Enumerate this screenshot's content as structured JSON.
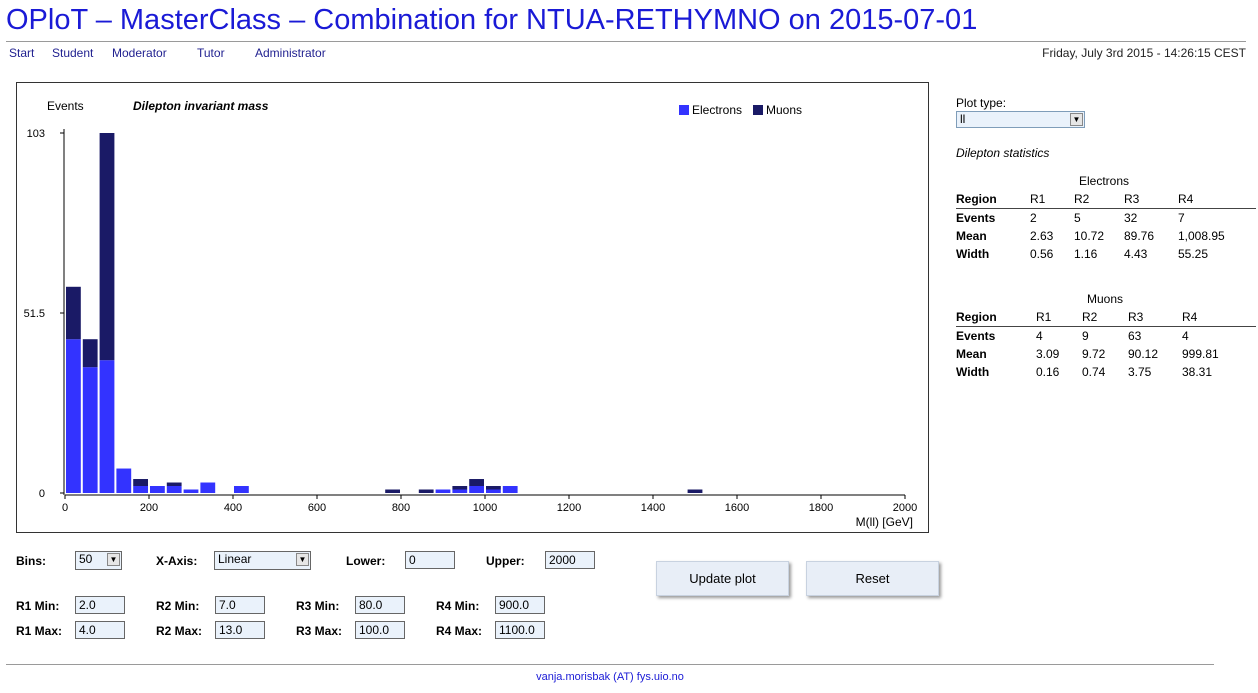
{
  "page": {
    "title": "OPloT – MasterClass – Combination for NTUA-RETHYMNO on 2015-07-01",
    "datetime": "Friday, July 3rd 2015 - 14:26:15 CEST",
    "footer": "vanja.morisbak (AT) fys.uio.no"
  },
  "nav": {
    "start": "Start",
    "student": "Student",
    "moderator": "Moderator",
    "tutor": "Tutor",
    "administrator": "Administrator"
  },
  "colors": {
    "electrons": "#3333ff",
    "muons": "#1a1a66",
    "title": "#1a1ad6"
  },
  "chart_data": {
    "type": "bar",
    "stacked": true,
    "title": "Dilepton invariant mass",
    "ylabel": "Events",
    "xlabel": "M(ll) [GeV]",
    "xlim": [
      0,
      2000
    ],
    "ylim": [
      0,
      103
    ],
    "x_ticks": [
      "0",
      "200",
      "400",
      "600",
      "800",
      "1000",
      "1200",
      "1400",
      "1600",
      "1800",
      "2000"
    ],
    "y_ticks": [
      "0",
      "51.5",
      "103"
    ],
    "legend": "top-right",
    "bin_width": 40,
    "bin_starts": [
      0,
      40,
      80,
      120,
      160,
      200,
      240,
      280,
      320,
      400,
      760,
      840,
      880,
      920,
      960,
      1000,
      1040,
      1480
    ],
    "series": [
      {
        "name": "Electrons",
        "values": [
          44,
          36,
          38,
          7,
          2,
          2,
          2,
          1,
          3,
          2,
          0,
          0,
          1,
          1,
          2,
          1,
          2,
          0
        ]
      },
      {
        "name": "Muons",
        "values": [
          15,
          8,
          65,
          0,
          2,
          0,
          1,
          0,
          0,
          0,
          1,
          1,
          0,
          1,
          2,
          1,
          0,
          1
        ]
      }
    ]
  },
  "side": {
    "plot_type_label": "Plot type:",
    "plot_type_value": "ll",
    "stats_title": "Dilepton statistics"
  },
  "electrons_table": {
    "caption": "Electrons",
    "headers": [
      "Region",
      "R1",
      "R2",
      "R3",
      "R4"
    ],
    "rows": [
      [
        "Events",
        "2",
        "5",
        "32",
        "7"
      ],
      [
        "Mean",
        "2.63",
        "10.72",
        "89.76",
        "1,008.95"
      ],
      [
        "Width",
        "0.56",
        "1.16",
        "4.43",
        "55.25"
      ]
    ]
  },
  "muons_table": {
    "caption": "Muons",
    "headers": [
      "Region",
      "R1",
      "R2",
      "R3",
      "R4"
    ],
    "rows": [
      [
        "Events",
        "4",
        "9",
        "63",
        "4"
      ],
      [
        "Mean",
        "3.09",
        "9.72",
        "90.12",
        "999.81"
      ],
      [
        "Width",
        "0.16",
        "0.74",
        "3.75",
        "38.31"
      ]
    ]
  },
  "controls": {
    "bins_label": "Bins:",
    "bins_value": "50",
    "xaxis_label": "X-Axis:",
    "xaxis_value": "Linear",
    "lower_label": "Lower:",
    "lower_value": "0",
    "upper_label": "Upper:",
    "upper_value": "2000",
    "r1min_label": "R1 Min:",
    "r1min_value": "2.0",
    "r1max_label": "R1 Max:",
    "r1max_value": "4.0",
    "r2min_label": "R2 Min:",
    "r2min_value": "7.0",
    "r2max_label": "R2 Max:",
    "r2max_value": "13.0",
    "r3min_label": "R3 Min:",
    "r3min_value": "80.0",
    "r3max_label": "R3 Max:",
    "r3max_value": "100.0",
    "r4min_label": "R4 Min:",
    "r4min_value": "900.0",
    "r4max_label": "R4 Max:",
    "r4max_value": "1100.0",
    "update_label": "Update plot",
    "reset_label": "Reset"
  }
}
